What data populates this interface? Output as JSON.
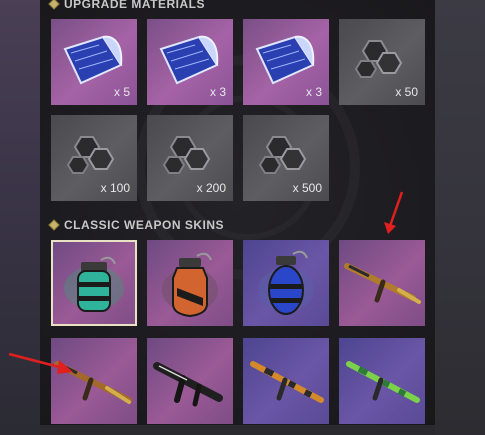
{
  "sections": {
    "upgrade": {
      "title": "UPGRADE MATERIALS"
    },
    "skins": {
      "title": "CLASSIC WEAPON SKINS"
    }
  },
  "upgrade_items": [
    {
      "icon": "blueprint-icon",
      "qty": "x 5"
    },
    {
      "icon": "blueprint-icon",
      "qty": "x 3"
    },
    {
      "icon": "blueprint-icon",
      "qty": "x 3"
    },
    {
      "icon": "hex-parts-icon",
      "qty": "x 50"
    },
    {
      "icon": "hex-parts-icon",
      "qty": "x 100"
    },
    {
      "icon": "hex-parts-icon",
      "qty": "x 200"
    },
    {
      "icon": "hex-parts-icon",
      "qty": "x 500"
    }
  ],
  "skin_items": [
    {
      "icon": "grenade-green-icon",
      "selected": true
    },
    {
      "icon": "grenade-orange-icon",
      "selected": false
    },
    {
      "icon": "grenade-blue-icon",
      "selected": false
    },
    {
      "icon": "rifle-wood-gold-icon",
      "selected": false
    },
    {
      "icon": "rifle-wood-gold-icon",
      "selected": false
    },
    {
      "icon": "smg-black-icon",
      "selected": false
    },
    {
      "icon": "rifle-camo-orange-icon",
      "selected": false
    },
    {
      "icon": "rifle-camo-green-icon",
      "selected": false
    }
  ],
  "colors": {
    "accent": "#c9b56a",
    "annotation_arrow": "#e0201f",
    "selected_border": "#e9e1c4"
  }
}
